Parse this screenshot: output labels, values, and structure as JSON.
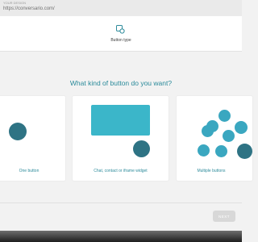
{
  "browser": {
    "caption": "YOUR DESIGN",
    "url": "https://conversario.com/"
  },
  "header": {
    "step_label": "Button type",
    "step_icon": "button-type-icon"
  },
  "main": {
    "question": "What kind of button do you want?",
    "options": [
      {
        "label": "One button"
      },
      {
        "label": "Chat, contact or iframe widget"
      },
      {
        "label": "Multiple buttons"
      }
    ]
  },
  "footer": {
    "next_label": "NEXT"
  },
  "colors": {
    "accent": "#2d8b9b",
    "circle": "#2e7384",
    "widget": "#3bb6c9",
    "bubble": "#3aa7c0"
  }
}
